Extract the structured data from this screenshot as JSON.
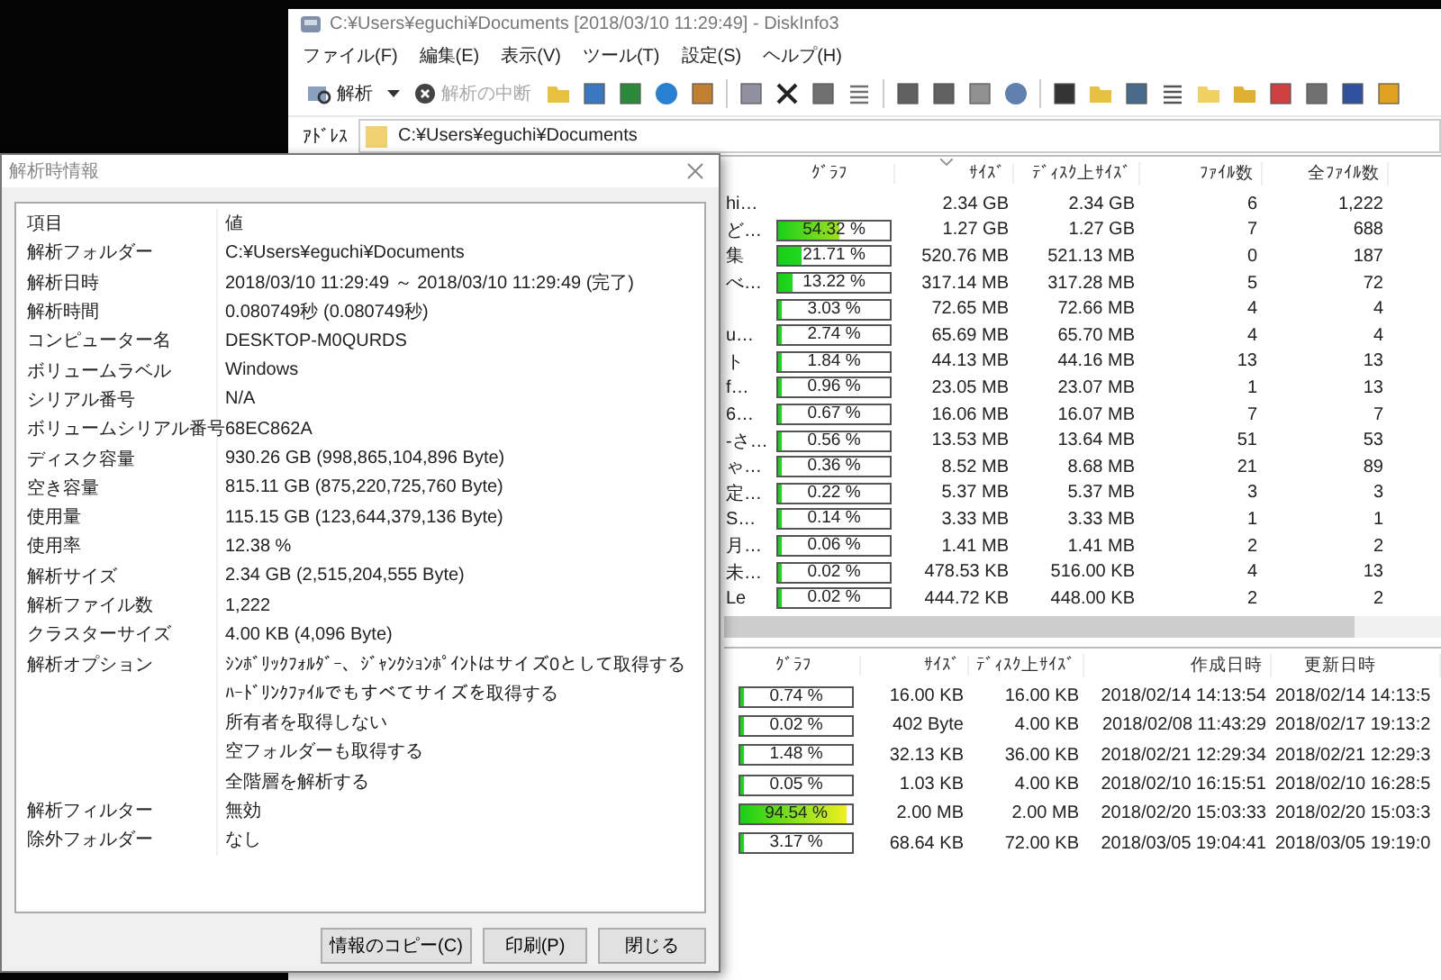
{
  "main_window": {
    "title": "C:¥Users¥eguchi¥Documents [2018/03/10 11:29:49] - DiskInfo3",
    "menu": [
      "ファイル(F)",
      "編集(E)",
      "表示(V)",
      "ツール(T)",
      "設定(S)",
      "ヘルプ(H)"
    ],
    "toolbar": [
      {
        "label": "解析",
        "disabled": false
      },
      {
        "label": "解析の中断",
        "disabled": true
      }
    ],
    "address": {
      "label": "ｱﾄﾞﾚｽ",
      "value": "C:¥Users¥eguchi¥Documents"
    },
    "upper_table": {
      "columns": [
        "ｸﾞﾗﾌ",
        "ｻｲｽﾞ",
        "ﾃﾞｨｽｸ上ｻｲｽﾞ",
        "ﾌｧｲﾙ数",
        "全ﾌｧｲﾙ数"
      ],
      "rows": [
        {
          "name": "hi…",
          "size": "2.34 GB",
          "disk_size": "2.34 GB",
          "files": "6",
          "total_files": "1,222"
        },
        {
          "name": "ど…",
          "percent": "54.32 %",
          "level": 0.5432,
          "size": "1.27 GB",
          "disk_size": "1.27 GB",
          "files": "7",
          "total_files": "688"
        },
        {
          "name": "集",
          "percent": "21.71 %",
          "level": 0.2171,
          "size": "520.76 MB",
          "disk_size": "521.13 MB",
          "files": "0",
          "total_files": "187"
        },
        {
          "name": "べ…",
          "percent": "13.22 %",
          "level": 0.1322,
          "size": "317.14 MB",
          "disk_size": "317.28 MB",
          "files": "5",
          "total_files": "72"
        },
        {
          "percent": "3.03 %",
          "level": 0.0303,
          "size": "72.65 MB",
          "disk_size": "72.66 MB",
          "files": "4",
          "total_files": "4"
        },
        {
          "name": "u…",
          "percent": "2.74 %",
          "level": 0.0274,
          "size": "65.69 MB",
          "disk_size": "65.70 MB",
          "files": "4",
          "total_files": "4"
        },
        {
          "name": "ト",
          "percent": "1.84 %",
          "level": 0.0184,
          "size": "44.13 MB",
          "disk_size": "44.16 MB",
          "files": "13",
          "total_files": "13"
        },
        {
          "name": "f…",
          "percent": "0.96 %",
          "level": 0.0096,
          "size": "23.05 MB",
          "disk_size": "23.07 MB",
          "files": "1",
          "total_files": "13"
        },
        {
          "name": "6…",
          "percent": "0.67 %",
          "level": 0.0067,
          "size": "16.06 MB",
          "disk_size": "16.07 MB",
          "files": "7",
          "total_files": "7"
        },
        {
          "name": "-さ…",
          "percent": "0.56 %",
          "level": 0.0056,
          "size": "13.53 MB",
          "disk_size": "13.64 MB",
          "files": "51",
          "total_files": "53"
        },
        {
          "name": "ゃ…",
          "percent": "0.36 %",
          "level": 0.0036,
          "size": "8.52 MB",
          "disk_size": "8.68 MB",
          "files": "21",
          "total_files": "89"
        },
        {
          "name": "定…",
          "percent": "0.22 %",
          "level": 0.0022,
          "size": "5.37 MB",
          "disk_size": "5.37 MB",
          "files": "3",
          "total_files": "3"
        },
        {
          "name": "S…",
          "percent": "0.14 %",
          "level": 0.0014,
          "size": "3.33 MB",
          "disk_size": "3.33 MB",
          "files": "1",
          "total_files": "1"
        },
        {
          "name": "月…",
          "percent": "0.06 %",
          "level": 0.0006,
          "size": "1.41 MB",
          "disk_size": "1.41 MB",
          "files": "2",
          "total_files": "2"
        },
        {
          "name": "未…",
          "percent": "0.02 %",
          "level": 0.0002,
          "size": "478.53 KB",
          "disk_size": "516.00 KB",
          "files": "4",
          "total_files": "13"
        },
        {
          "name": "Le",
          "percent": "0.02 %",
          "level": 0.0002,
          "size": "444.72 KB",
          "disk_size": "448.00 KB",
          "files": "2",
          "total_files": "2"
        }
      ]
    },
    "lower_table": {
      "columns": [
        "ｸﾞﾗﾌ",
        "ｻｲｽﾞ",
        "ﾃﾞｨｽｸ上ｻｲｽﾞ",
        "作成日時",
        "更新日時"
      ],
      "rows": [
        {
          "percent": "0.74 %",
          "level": 0.0074,
          "size": "16.00 KB",
          "disk_size": "16.00 KB",
          "created": "2018/02/14 14:13:54",
          "modified": "2018/02/14 14:13:5"
        },
        {
          "percent": "0.02 %",
          "level": 0.0002,
          "size": "402 Byte",
          "disk_size": "4.00 KB",
          "created": "2018/02/08 11:43:29",
          "modified": "2018/02/17 19:13:2"
        },
        {
          "percent": "1.48 %",
          "level": 0.0148,
          "size": "32.13 KB",
          "disk_size": "36.00 KB",
          "created": "2018/02/21 12:29:34",
          "modified": "2018/02/21 12:29:3"
        },
        {
          "percent": "0.05 %",
          "level": 0.0005,
          "size": "1.03 KB",
          "disk_size": "4.00 KB",
          "created": "2018/02/10 16:15:51",
          "modified": "2018/02/10 16:28:5"
        },
        {
          "percent": "94.54 %",
          "level": 0.9454,
          "size": "2.00 MB",
          "disk_size": "2.00 MB",
          "created": "2018/02/20 15:03:33",
          "modified": "2018/02/20 15:03:3"
        },
        {
          "percent": "3.17 %",
          "level": 0.0317,
          "size": "68.64 KB",
          "disk_size": "72.00 KB",
          "created": "2018/03/05 19:04:41",
          "modified": "2018/03/05 19:19:0"
        }
      ]
    }
  },
  "dialog": {
    "title": "解析時情報",
    "columns": [
      "項目",
      "値"
    ],
    "rows": [
      {
        "item": "解析フォルダー",
        "value": "C:¥Users¥eguchi¥Documents"
      },
      {
        "item": "解析日時",
        "value": "2018/03/10 11:29:49 ～ 2018/03/10 11:29:49 (完了)"
      },
      {
        "item": "解析時間",
        "value": "0.080749秒 (0.080749秒)"
      },
      {
        "item": "コンピューター名",
        "value": "DESKTOP-M0QURDS"
      },
      {
        "item": "ボリュームラベル",
        "value": "Windows"
      },
      {
        "item": "シリアル番号",
        "value": "N/A"
      },
      {
        "item": "ボリュームシリアル番号",
        "value": "68EC862A"
      },
      {
        "item": "ディスク容量",
        "value": "930.26 GB (998,865,104,896 Byte)"
      },
      {
        "item": "空き容量",
        "value": "815.11 GB (875,220,725,760 Byte)"
      },
      {
        "item": "使用量",
        "value": "115.15 GB (123,644,379,136 Byte)"
      },
      {
        "item": "使用率",
        "value": "12.38 %"
      },
      {
        "item": "解析サイズ",
        "value": "2.34 GB (2,515,204,555 Byte)"
      },
      {
        "item": "解析ファイル数",
        "value": "1,222"
      },
      {
        "item": "クラスターサイズ",
        "value": "4.00 KB (4,096 Byte)"
      },
      {
        "item": "解析オプション",
        "value": "ｼﾝﾎﾞﾘｯｸﾌｫﾙﾀﾞｰ、ｼﾞｬﾝｸｼｮﾝﾎﾟｲﾝﾄはサイズ0として取得する"
      },
      {
        "value": "ﾊｰﾄﾞﾘﾝｸﾌｧｲﾙでもすべてサイズを取得する"
      },
      {
        "value": "所有者を取得しない"
      },
      {
        "value": "空フォルダーも取得する"
      },
      {
        "value": "全階層を解析する"
      },
      {
        "item": "解析フィルター",
        "value": "無効"
      },
      {
        "item": "除外フォルダー",
        "value": "なし"
      }
    ],
    "buttons": [
      "情報のコピー(C)",
      "印刷(P)",
      "閉じる"
    ]
  }
}
